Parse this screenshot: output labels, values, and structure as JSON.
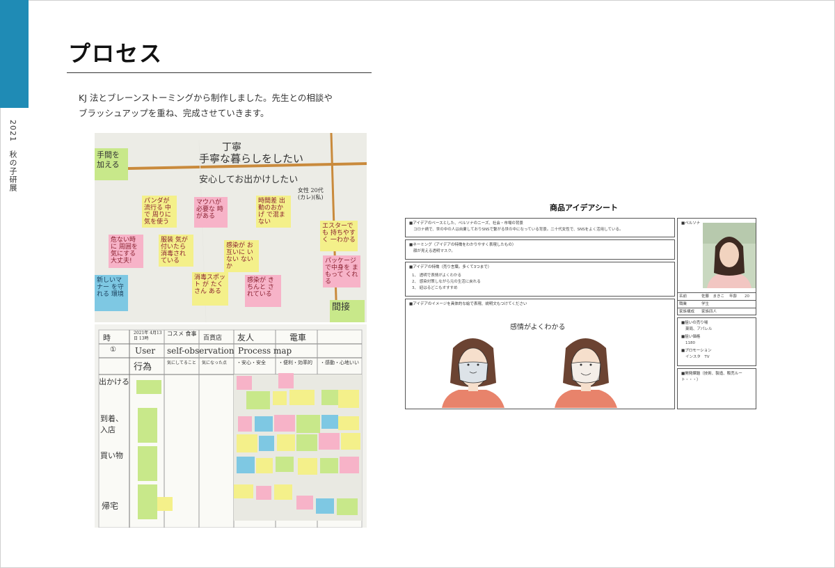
{
  "side": {
    "label": "2021　秋の子研展"
  },
  "page": {
    "title": "プロセス",
    "intro_line1": "KJ 法とブレーンストーミングから制作しました。先生との相談や",
    "intro_line2": "ブラッシュアップを重ね、完成させていきます。"
  },
  "photo_top": {
    "heading1": "手間を加える",
    "heading2": "丁寧",
    "heading3": "手寧な暮らしをしたい",
    "heading4": "安心してお出かけしたい",
    "side_note": "女性 20代 (カレ)(私)",
    "notes": [
      {
        "text": "パンダが流行る 中で 周りに 気を使う",
        "color": "#f4f08a"
      },
      {
        "text": "マウハが 必要な 時がある",
        "color": "#f7b3c8"
      },
      {
        "text": "時間差 出勤のおかげ で混まない",
        "color": "#f4f08a"
      },
      {
        "text": "エスターでも 持ちやすく 一わかる",
        "color": "#f4f08a"
      },
      {
        "text": "危ない時に 周囲を 気にする 大丈夫!",
        "color": "#f7b3c8"
      },
      {
        "text": "服装 気が付いたら 消毒されている",
        "color": "#f4f08a"
      },
      {
        "text": "感染が お互いに いない ないか",
        "color": "#f4f08a"
      },
      {
        "text": "パッケージ で中身を まもって くれる",
        "color": "#f7b3c8"
      },
      {
        "text": "消毒スポット が たくさん ある",
        "color": "#f4f08a"
      },
      {
        "text": "感染が きちんと されている",
        "color": "#f7b3c8"
      },
      {
        "text": "新しいマナー を守れる 環境",
        "color": "#7ec8e3"
      },
      {
        "text": "間接",
        "color": "#c8e88a"
      }
    ]
  },
  "photo_bottom": {
    "header": [
      "時",
      "2021年 4月13日 13時",
      "コスメ 食事",
      "百貨店",
      "友人",
      "電車"
    ],
    "row1": [
      "①",
      "User",
      "self-observation",
      "Process map"
    ],
    "row2": [
      "行為",
      "気にしてること",
      "気になった点",
      "・安心・安全",
      "・便利・効率的",
      "・感動・心地いい"
    ],
    "rows": [
      "出かける",
      "到着、入店",
      "買い物",
      "帰宅"
    ]
  },
  "sheet": {
    "title": "商品アイデアシート",
    "section1_head": "■アイデアのベースとした、ペルソナのニーズ、社会・市場の背景",
    "section1_body": "コロナ禍で、世の中の人は自粛しておりSNSで繋がる世の中になっている背景。二十代女性で、SNSをよく活用している。",
    "section2_head": "■ネーミング（アイデアの特徴をわかりやすく表現したもの）",
    "section2_body": "顔が見える透明マスク。",
    "section3_head": "■アイデアの特徴（売り言葉。多くて3つまで）",
    "features": [
      "1、 透明で表情がよくわかる",
      "2、 感染対策しながら元の生活に戻れる",
      "3、 紐はるどこもオすすめ"
    ],
    "section4_head": "■アイデアのイメージを具体的な絵で表現、説明文もつけてください",
    "caption": "感情がよくわかる",
    "persona_head": "■ペルソナ",
    "name_label": "名前",
    "name_value": "佐藤　まきこ",
    "age_label": "年齢",
    "age_value": "20",
    "job_label": "職業",
    "job_value": "学生",
    "family_label": "家族構成",
    "family_value": "家族四人",
    "place_head": "■狙いの売り場",
    "place_value": "薬局、アパレル",
    "price_head": "■狙い価格",
    "price_value": "1180",
    "promo_head": "■プロモーション",
    "promo_value": "インスタ　TV",
    "dev_head": "■開発課題（技術、製造、販売ルート・・・）"
  }
}
